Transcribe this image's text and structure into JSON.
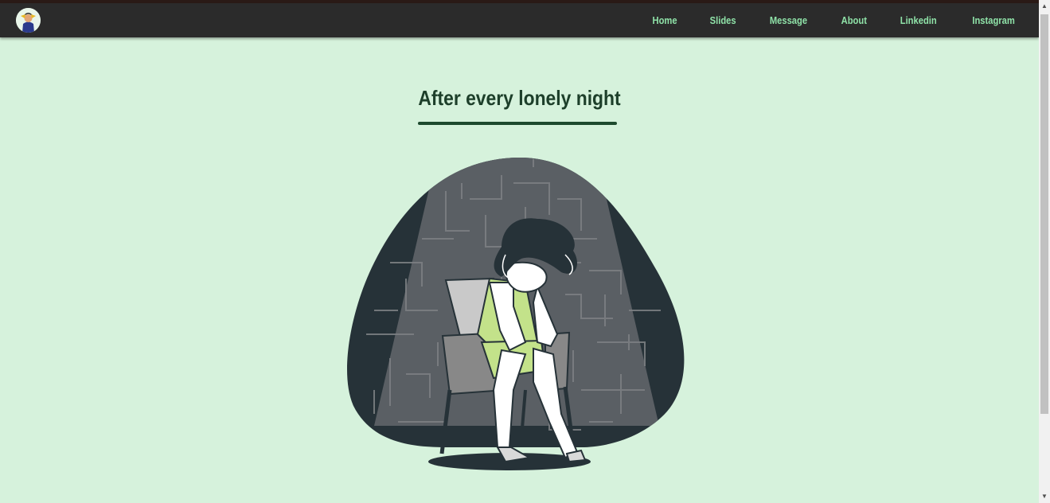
{
  "nav": {
    "links": [
      "Home",
      "Slides",
      "Message",
      "About",
      "Linkedin",
      "Instagram"
    ]
  },
  "main": {
    "title": "After every lonely night"
  },
  "colors": {
    "background": "#d6f2dc",
    "navbar": "#2b2b2b",
    "nav_link": "#8fe2a8",
    "title": "#1d3f2a",
    "accent_green": "#c3e28a"
  },
  "icons": {
    "logo": "user-avatar-logo-icon",
    "illustration": "sad-woman-on-chair-illustration"
  }
}
